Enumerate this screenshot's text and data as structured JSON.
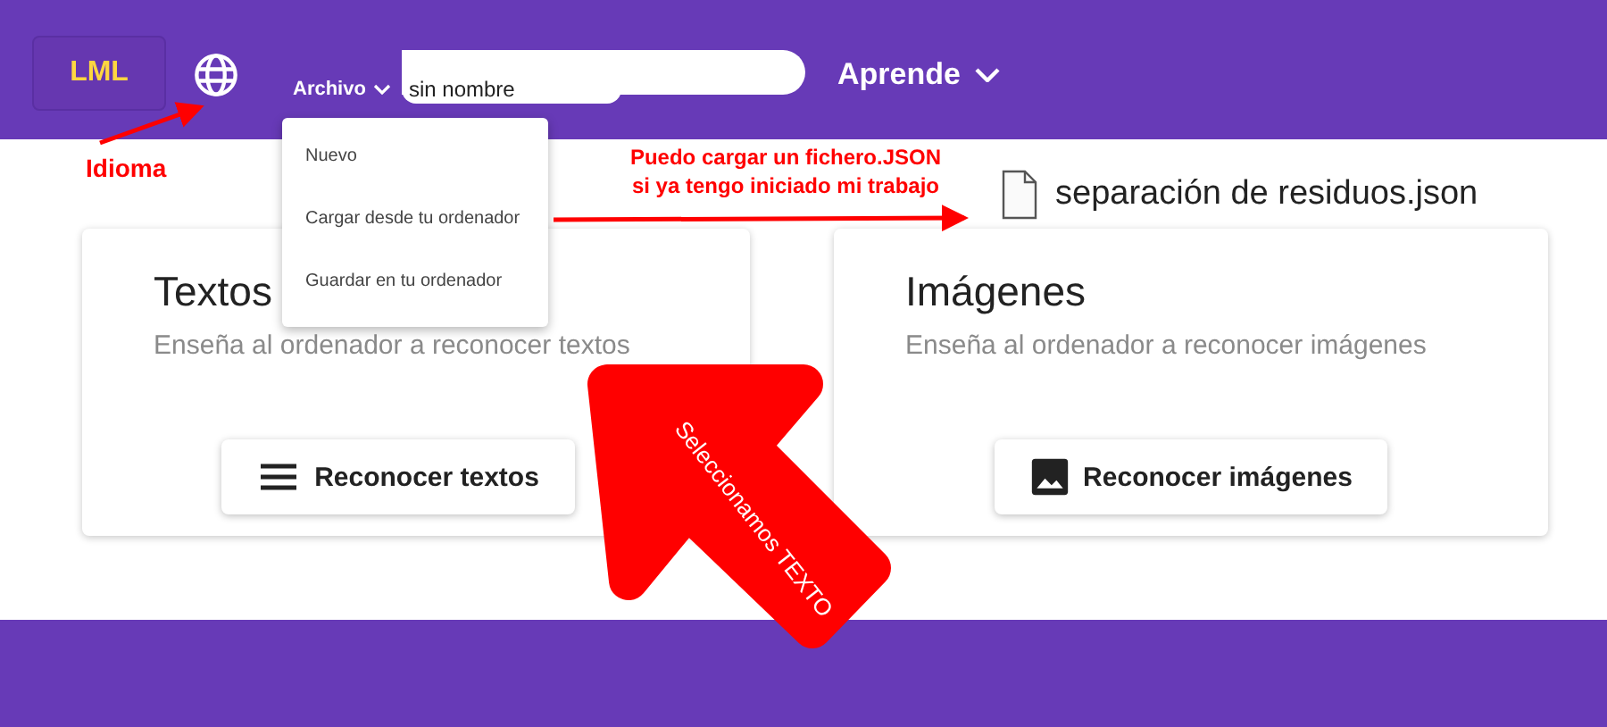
{
  "header": {
    "logo": "LML",
    "file_menu": {
      "label": "Archivo",
      "expanded": true
    },
    "project_name": "sin nombre",
    "learn_menu": {
      "label": "Aprende"
    }
  },
  "file_menu_items": [
    "Nuevo",
    "Cargar desde tu ordenador",
    "Guardar en tu ordenador"
  ],
  "cards": [
    {
      "kind": "text",
      "title": "Textos",
      "subtitle": "Enseña al ordenador a reconocer textos",
      "button": "Reconocer textos"
    },
    {
      "kind": "image",
      "title": "Imágenes",
      "subtitle": "Enseña al ordenador a reconocer imágenes",
      "button": "Reconocer imágenes"
    }
  ],
  "annotations": {
    "language_label": "Idioma",
    "load_note": [
      "Puedo cargar un fichero.JSON",
      "si ya tengo iniciado mi trabajo"
    ],
    "file_name": "separación de residuos.json",
    "arrow_text": "Seleccionamos TEXTO"
  }
}
